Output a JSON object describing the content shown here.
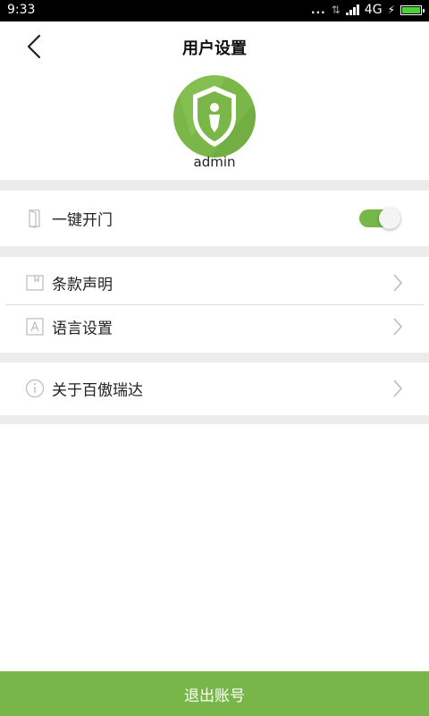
{
  "status_bar": {
    "time": "9:33",
    "dots": "...",
    "network": "4G",
    "battery_level": 1.0,
    "battery_color": "#4cd137"
  },
  "header": {
    "title": "用户设置",
    "back_icon": "chevron-left-icon"
  },
  "profile": {
    "avatar_icon": "shield-user-icon",
    "avatar_color": "#7ab648",
    "username": "admin"
  },
  "settings": {
    "one_key_open": {
      "label": "一键开门",
      "icon": "door-icon",
      "enabled": true
    },
    "terms": {
      "label": "条款声明",
      "icon": "book-icon"
    },
    "language": {
      "label": "语言设置",
      "icon": "language-icon"
    },
    "about": {
      "label": "关于百傲瑞达",
      "icon": "info-icon"
    }
  },
  "logout": {
    "label": "退出账号"
  },
  "colors": {
    "accent": "#79b64a",
    "section_gap": "#ececec",
    "divider": "#dddddd"
  }
}
